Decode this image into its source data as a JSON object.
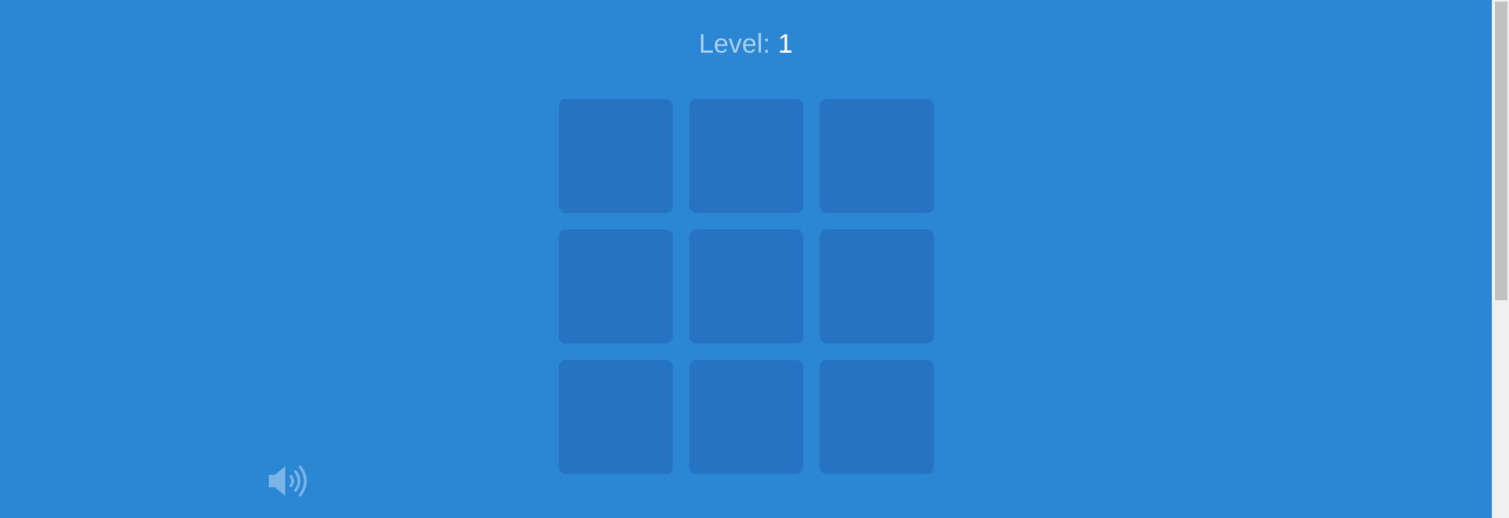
{
  "header": {
    "level_label": "Level:",
    "level_value": "1"
  },
  "board": {
    "rows": 3,
    "columns": 3,
    "tiles": [
      {
        "row": 1,
        "col": 1,
        "state": "idle"
      },
      {
        "row": 1,
        "col": 2,
        "state": "idle"
      },
      {
        "row": 1,
        "col": 3,
        "state": "idle"
      },
      {
        "row": 2,
        "col": 1,
        "state": "idle"
      },
      {
        "row": 2,
        "col": 2,
        "state": "idle"
      },
      {
        "row": 2,
        "col": 3,
        "state": "idle"
      },
      {
        "row": 3,
        "col": 1,
        "state": "idle"
      },
      {
        "row": 3,
        "col": 2,
        "state": "idle"
      },
      {
        "row": 3,
        "col": 3,
        "state": "idle"
      }
    ]
  },
  "controls": {
    "sound_icon": "speaker-volume-icon",
    "sound_on": true
  },
  "colors": {
    "background": "#2B87D3",
    "tile": "#2673C2",
    "level_label": "#A9CFF0",
    "level_value": "#FFFFFF",
    "sound_icon": "#7BB4E6"
  }
}
